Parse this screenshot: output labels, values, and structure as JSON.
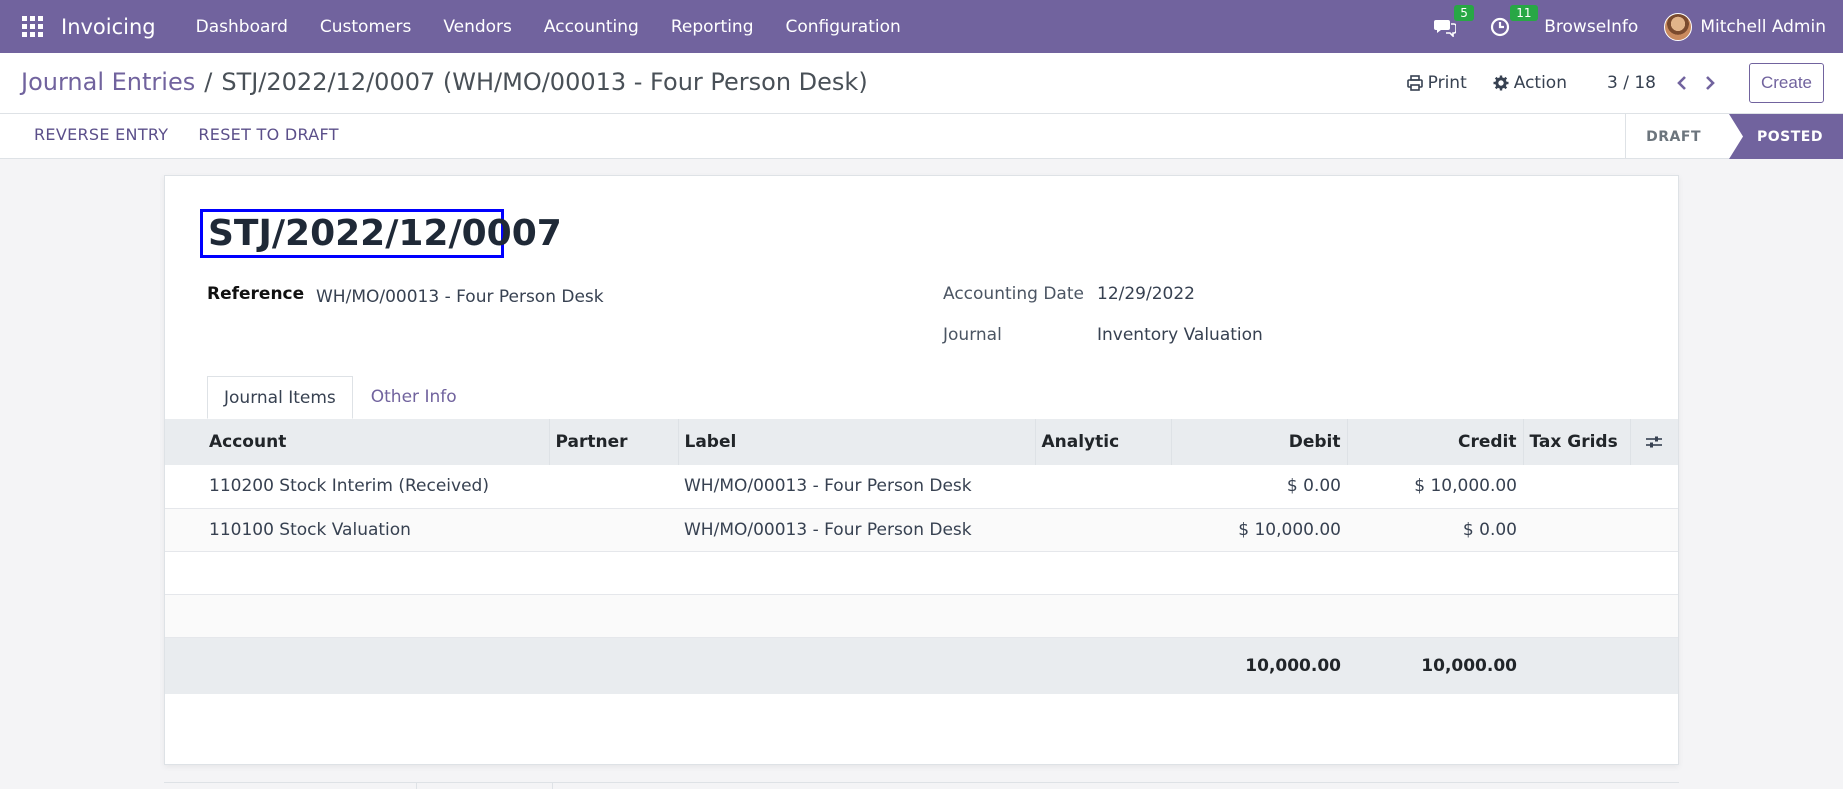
{
  "navbar": {
    "app_name": "Invoicing",
    "menu": [
      "Dashboard",
      "Customers",
      "Vendors",
      "Accounting",
      "Reporting",
      "Configuration"
    ],
    "messages_count": "5",
    "activities_count": "11",
    "company": "BrowseInfo",
    "user": "Mitchell Admin",
    "brand_color": "#71639e"
  },
  "breadcrumb": {
    "parent": "Journal Entries",
    "separator": "/",
    "current": "STJ/2022/12/0007 (WH/MO/00013 - Four Person Desk)"
  },
  "control": {
    "print_label": "Print",
    "action_label": "Action",
    "pager": "3 / 18",
    "prev_icon": "chevron-left-icon",
    "next_icon": "chevron-right-icon",
    "create_label": "Create"
  },
  "status": {
    "buttons": [
      "REVERSE ENTRY",
      "RESET TO DRAFT"
    ],
    "stages": [
      "DRAFT",
      "POSTED"
    ],
    "active_stage": "POSTED"
  },
  "form": {
    "title": "STJ/2022/12/0007",
    "reference_label": "Reference",
    "reference_value": "WH/MO/00013 - Four Person Desk",
    "date_label": "Accounting Date",
    "date_value": "12/29/2022",
    "journal_label": "Journal",
    "journal_value": "Inventory Valuation"
  },
  "tabs": [
    "Journal Items",
    "Other Info"
  ],
  "journal_items": {
    "columns": [
      "Account",
      "Partner",
      "Label",
      "Analytic",
      "Debit",
      "Credit",
      "Tax Grids"
    ],
    "rows": [
      {
        "account": "110200 Stock Interim (Received)",
        "partner": "",
        "label": "WH/MO/00013 - Four Person Desk",
        "analytic": "",
        "debit": "$ 0.00",
        "credit": "$ 10,000.00",
        "tax_grids": ""
      },
      {
        "account": "110100 Stock Valuation",
        "partner": "",
        "label": "WH/MO/00013 - Four Person Desk",
        "analytic": "",
        "debit": "$ 10,000.00",
        "credit": "$ 0.00",
        "tax_grids": ""
      }
    ],
    "total_debit": "10,000.00",
    "total_credit": "10,000.00"
  }
}
